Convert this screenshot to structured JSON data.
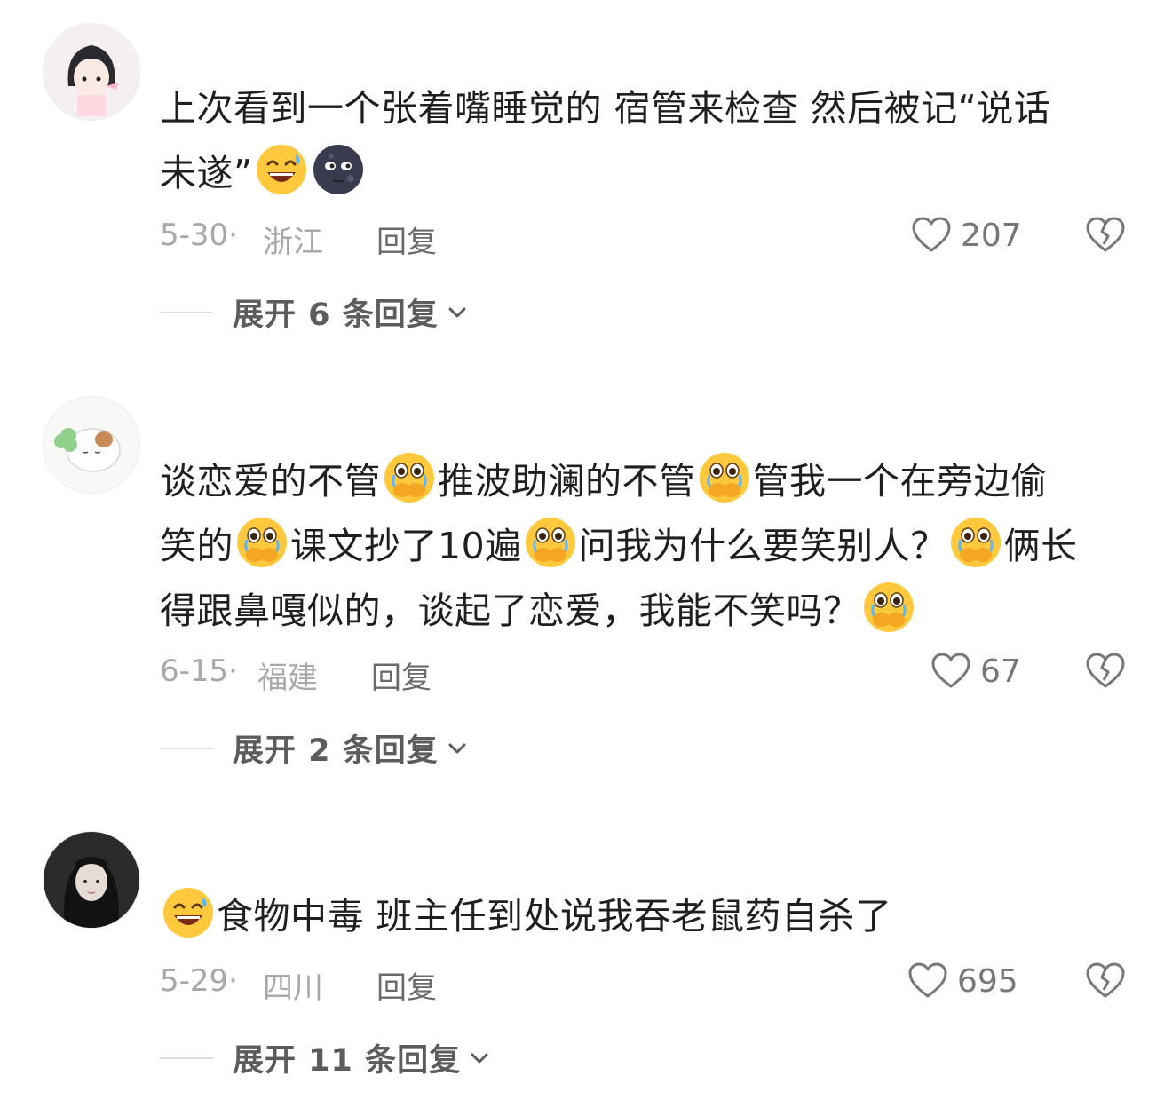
{
  "comments": [
    {
      "text_lines": [
        "上次看到一个张着嘴睡觉的 宿管来检查 然后被记“说话",
        "未遂”"
      ],
      "date": "5-30·",
      "region": "浙江",
      "reply_label": "回复",
      "likes": "207",
      "expand_label": "展开 6 条回复"
    },
    {
      "text_lines": [
        "谈恋爱的不管",
        "推波助澜的不管",
        "管我一个在旁边偷",
        "笑的",
        "课文抄了10遍",
        "问我为什么要笑别人？",
        "俩长",
        "得跟鼻嘎似的，谈起了恋爱，我能不笑吗？"
      ],
      "date": "6-15·",
      "region": "福建",
      "reply_label": "回复",
      "likes": "67",
      "expand_label": "展开 2 条回复"
    },
    {
      "text_lines": [
        "食物中毒 班主任到处说我吞老鼠药自杀了"
      ],
      "date": "5-29·",
      "region": "四川",
      "reply_label": "回复",
      "likes": "695",
      "expand_label": "展开 11 条回复"
    }
  ],
  "icons": {
    "like": "heart-outline-icon",
    "dislike": "broken-heart-icon",
    "expand": "chevron-down-icon",
    "emoji_smile": "grinning-sweat-emoji",
    "emoji_moon": "new-moon-face-emoji",
    "emoji_tears": "holding-back-tears-emoji"
  },
  "colors": {
    "text": "#1f1f1f",
    "meta": "#a8a8a8",
    "reply": "#6a6a6a",
    "icon": "#777777"
  }
}
